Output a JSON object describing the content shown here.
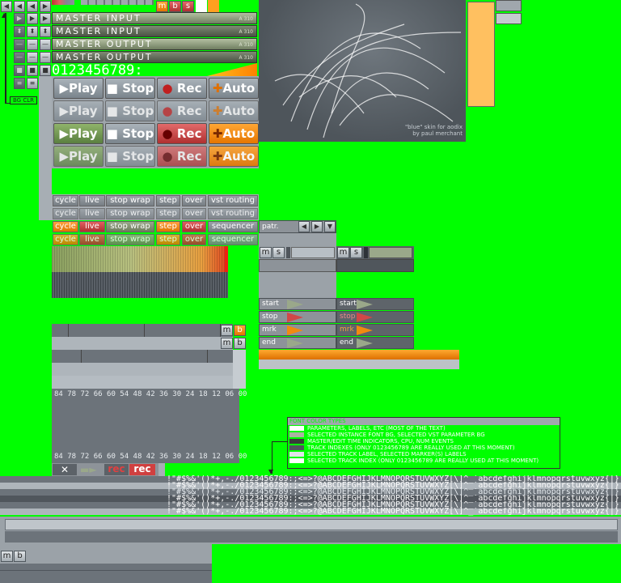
{
  "transport_icons": [
    "left-arrow",
    "left-arrow",
    "right-arrow",
    "right-arrow",
    "right-arrow",
    "down-arrow",
    "up-arrow",
    "up-arrow"
  ],
  "top_mbs": {
    "m": "m",
    "b": "b",
    "s": "s"
  },
  "io_bars": [
    {
      "label": "MASTER INPUT",
      "tag": "A 310"
    },
    {
      "label": "MASTER INPUT",
      "tag": "A 310"
    },
    {
      "label": "MASTER OUTPUT",
      "tag": "A 310"
    },
    {
      "label": "MASTER OUTPUT",
      "tag": "A 310"
    }
  ],
  "digits": "0123456789:",
  "bg_clr_label": "BG CLR",
  "buttons": {
    "play": "Play",
    "stop": "Stop",
    "rec": "Rec",
    "auto": "Auto"
  },
  "skin_credit": {
    "line1": "\"blue\" skin for aodix",
    "line2": "by paul merchant"
  },
  "small_buttons": [
    "cycle",
    "live",
    "stop wrap",
    "step",
    "over",
    "vst routing"
  ],
  "small_buttons_b": [
    "cycle",
    "live",
    "stop wrap",
    "step",
    "over",
    "sequencer"
  ],
  "pattern": {
    "label": "patr."
  },
  "pair_labels": {
    "m": "m",
    "s": "s"
  },
  "markers": [
    "start",
    "stop",
    "mrk",
    "end"
  ],
  "mb2": {
    "m": "m",
    "b": "b"
  },
  "ticks": "84 78 72 66 60 54 48 42 36 30 24 18 12 06 00",
  "bottom_buttons": {
    "close": "✕",
    "rec1": "rec",
    "rec2": "rec"
  },
  "legend": {
    "title": "FONT COLOR TYPES",
    "rows": [
      {
        "text": "PARAMETERS, LABELS, ETC (MOST OF THE TEXT)",
        "color": "#ffffff"
      },
      {
        "text": "SELECTED INSTANCE FONT BG, SELECTED VST PARAMETER BG",
        "color": "#aab4a0"
      },
      {
        "text": "MASTER/EDIT TIME INDICATORS, CPU, NUM EVENTS",
        "color": "#3a3a3a"
      },
      {
        "text": "TRACK INDEXES (ONLY 0123456789 ARE REALLY USED AT THIS MOMENT)",
        "color": "#50565c"
      },
      {
        "text": "SELECTED TRACK LABEL, SELECTED MARKER(S) LABELS",
        "color": "#e0e4e8"
      },
      {
        "text": "SELECTED TRACK INDEX (ONLY 0123456789 ARE REALLY USED AT THIS MOMENT)",
        "color": "#ffffff"
      }
    ]
  },
  "charset": " !\"#$%&'()*+,-./0123456789:;<=>?@ABCDEFGHIJKLMNOPQRSTUVWXYZ[\\]^_`abcdefghijklmnopqrstuvwxyz{|}~",
  "charset_colors": [
    "#ffffff",
    "#ffffff",
    "#e9eef2",
    "#ffffff",
    "#ffffff",
    "#ffffff"
  ],
  "bottom_mb": {
    "m": "m",
    "b": "b"
  }
}
